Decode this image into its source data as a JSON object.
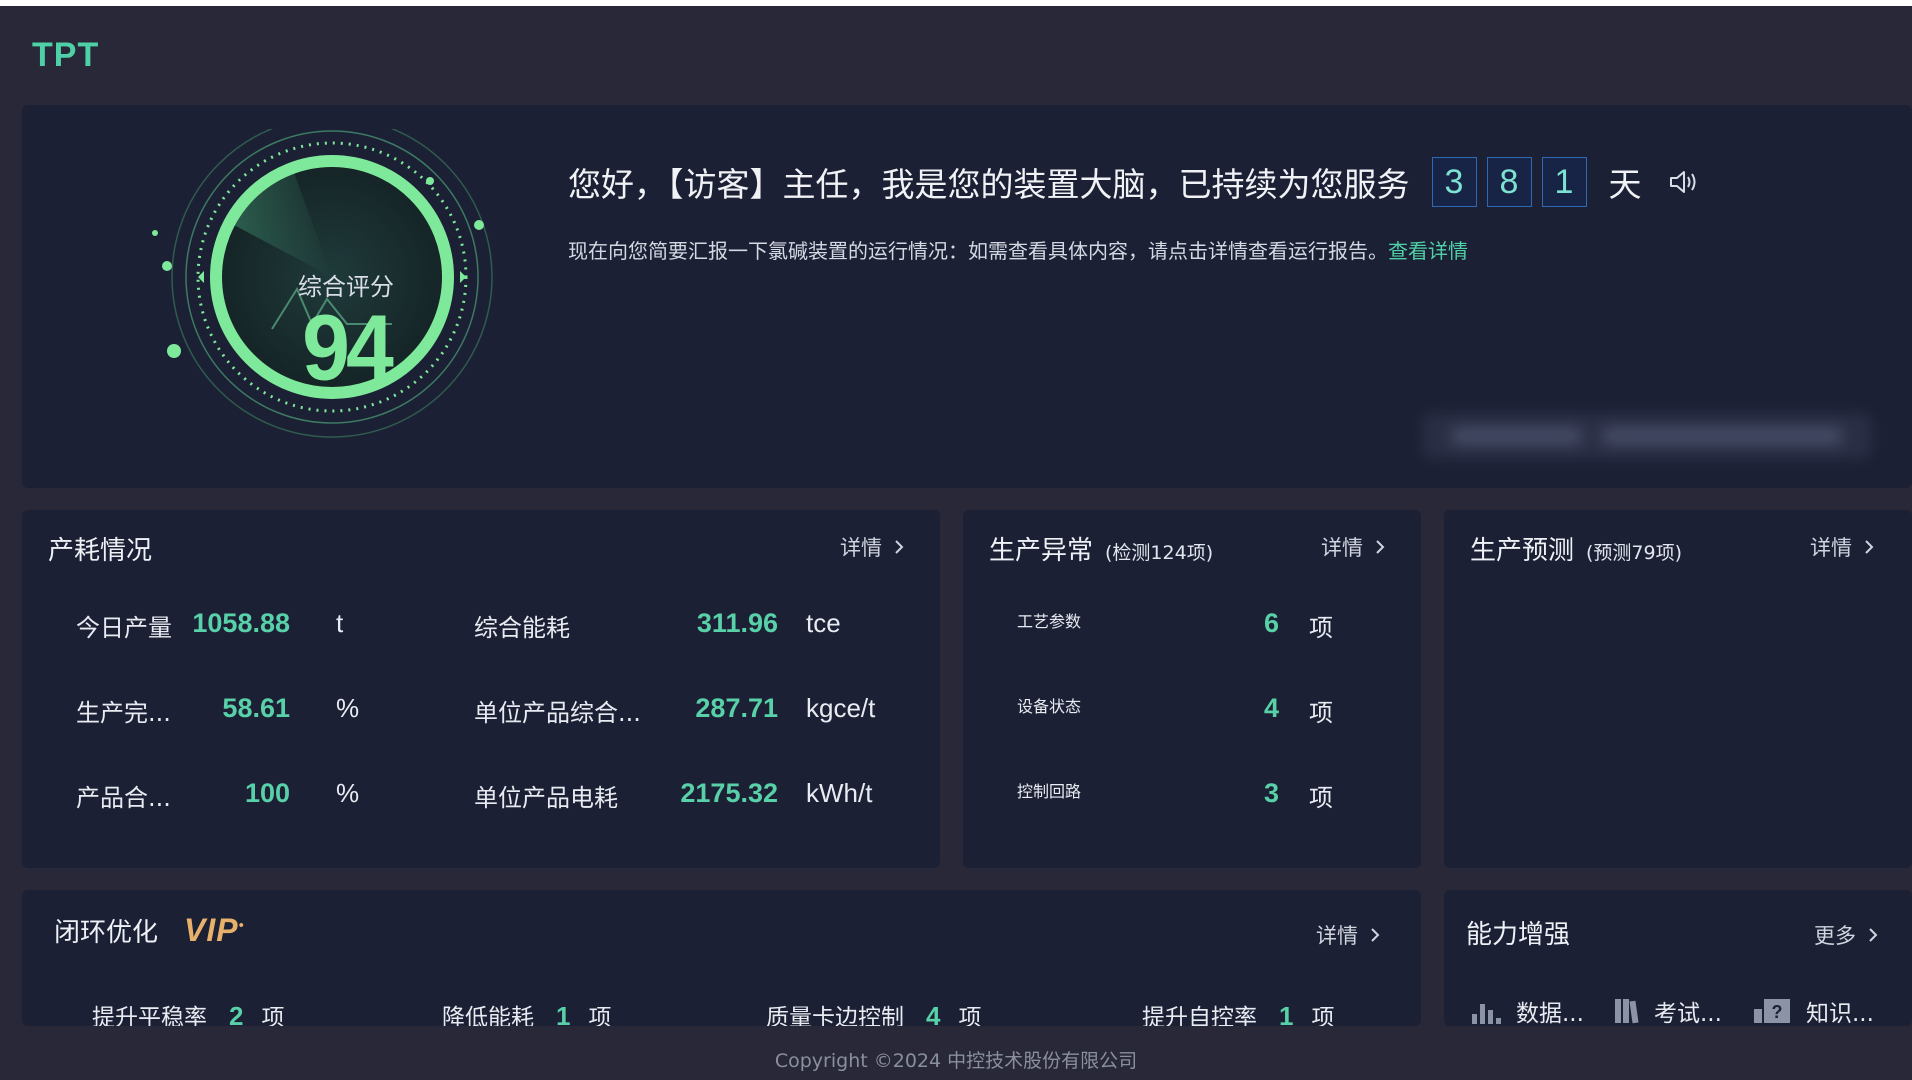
{
  "app": {
    "logo": "TPT"
  },
  "hero": {
    "score_label": "综合评分",
    "score_value": "94",
    "greeting": "您好，【访客】主任，我是您的装置大脑，已持续为您服务",
    "days_digits": [
      "3",
      "8",
      "1"
    ],
    "days_unit": "天",
    "subtitle": "现在向您简要汇报一下氯碱装置的运行情况：如需查看具体内容，请点击详情查看运行报告。",
    "subtitle_link": "查看详情",
    "colors": {
      "accent": "#4fd1a8",
      "score": "#7ee99a"
    }
  },
  "production": {
    "title": "产耗情况",
    "detail": "详情",
    "left": [
      {
        "label": "今日产量",
        "value": "1058.88",
        "unit": "t"
      },
      {
        "label": "生产完...",
        "value": "58.61",
        "unit": "%"
      },
      {
        "label": "产品合...",
        "value": "100",
        "unit": "%"
      }
    ],
    "right": [
      {
        "label": "综合能耗",
        "value": "311.96",
        "unit": "tce"
      },
      {
        "label": "单位产品综合...",
        "value": "287.71",
        "unit": "kgce/t"
      },
      {
        "label": "单位产品电耗",
        "value": "2175.32",
        "unit": "kWh/t"
      }
    ]
  },
  "anomaly": {
    "title": "生产异常",
    "subtitle": "(检测124项)",
    "detail": "详情",
    "items": [
      {
        "label": "工艺参数",
        "value": "6",
        "unit": "项"
      },
      {
        "label": "设备状态",
        "value": "4",
        "unit": "项"
      },
      {
        "label": "控制回路",
        "value": "3",
        "unit": "项"
      }
    ]
  },
  "forecast": {
    "title": "生产预测",
    "subtitle": "(预测79项)",
    "detail": "详情"
  },
  "closed_loop": {
    "title": "闭环优化",
    "badge": "VIP",
    "detail": "详情",
    "items": [
      {
        "label": "提升平稳率",
        "value": "2",
        "unit": "项"
      },
      {
        "label": "降低能耗",
        "value": "1",
        "unit": "项"
      },
      {
        "label": "质量卡边控制",
        "value": "4",
        "unit": "项"
      },
      {
        "label": "提升自控率",
        "value": "1",
        "unit": "项"
      }
    ]
  },
  "enhance": {
    "title": "能力增强",
    "more": "更多",
    "items": [
      {
        "label": "数据...",
        "icon": "bar-chart-icon"
      },
      {
        "label": "考试...",
        "icon": "book-icon"
      },
      {
        "label": "知识...",
        "icon": "question-icon"
      }
    ]
  },
  "footer": {
    "copyright": "Copyright ©2024 中控技术股份有限公司"
  }
}
